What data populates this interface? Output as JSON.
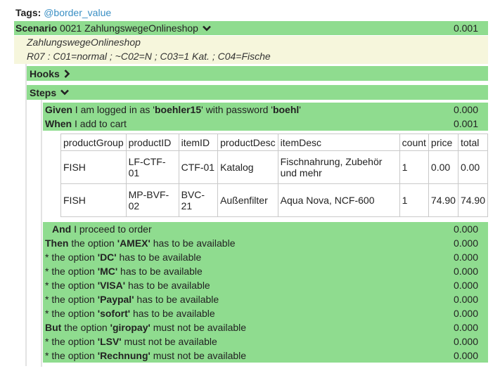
{
  "tags": {
    "label": "Tags:",
    "value": "@border_value"
  },
  "scenario": {
    "keyword": "Scenario",
    "title": "0021 ZahlungswegeOnlineshop",
    "duration": "0.001",
    "description_line1": "ZahlungswegeOnlineshop",
    "description_line2": "R07 : C01=normal ; ~C02=N ; C03=1 Kat. ; C04=Fische"
  },
  "hooks": {
    "label": "Hooks"
  },
  "steps_section": {
    "label": "Steps"
  },
  "steps": [
    {
      "keyword": "Given",
      "parts": [
        " I am logged in as '",
        "boehler15",
        "' with password '",
        "boehl",
        "'"
      ],
      "duration": "0.000"
    },
    {
      "keyword": "When",
      "parts": [
        " I add to cart"
      ],
      "duration": "0.001"
    },
    {
      "keyword": "And",
      "parts": [
        " I proceed to order"
      ],
      "duration": "0.000"
    },
    {
      "keyword": "Then",
      "parts": [
        " the option ",
        "'AMEX'",
        " has to be available"
      ],
      "duration": "0.000"
    },
    {
      "keyword": "*",
      "parts": [
        " the option ",
        "'DC'",
        " has to be available"
      ],
      "duration": "0.000"
    },
    {
      "keyword": "*",
      "parts": [
        " the option ",
        "'MC'",
        " has to be available"
      ],
      "duration": "0.000"
    },
    {
      "keyword": "*",
      "parts": [
        " the option ",
        "'VISA'",
        " has to be available"
      ],
      "duration": "0.000"
    },
    {
      "keyword": "*",
      "parts": [
        " the option ",
        "'Paypal'",
        " has to be available"
      ],
      "duration": "0.000"
    },
    {
      "keyword": "*",
      "parts": [
        " the option ",
        "'sofort'",
        " has to be available"
      ],
      "duration": "0.000"
    },
    {
      "keyword": "But",
      "parts": [
        " the option ",
        "'giropay'",
        " must not be available"
      ],
      "duration": "0.000"
    },
    {
      "keyword": "*",
      "parts": [
        " the option ",
        "'LSV'",
        " must not be available"
      ],
      "duration": "0.000"
    },
    {
      "keyword": "*",
      "parts": [
        " the option ",
        "'Rechnung'",
        " must not be available"
      ],
      "duration": "0.000"
    }
  ],
  "table": {
    "headers": [
      "productGroup",
      "productID",
      "itemID",
      "productDesc",
      "itemDesc",
      "count",
      "price",
      "total"
    ],
    "rows": [
      [
        "FISH",
        "LF-CTF-01",
        "CTF-01",
        "Katalog",
        "Fischnahrung, Zubehör und mehr",
        "1",
        "0.00",
        "0.00"
      ],
      [
        "FISH",
        "MP-BVF-02",
        "BVC-21",
        "Außenfilter",
        "Aqua Nova, NCF-600",
        "1",
        "74.90",
        "74.90"
      ]
    ]
  },
  "icons": {
    "expand": "chevron-down-icon",
    "collapsed": "chevron-right-icon"
  },
  "colors": {
    "step_bg": "#8fdc8f",
    "description_bg": "#f6f6dc",
    "tag": "#3a8fc4"
  }
}
